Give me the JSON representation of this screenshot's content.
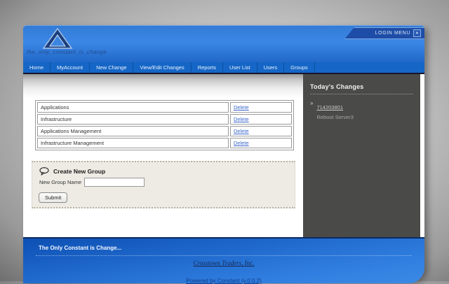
{
  "header": {
    "login_menu_label": "LOGIN MENU",
    "logo_tagline": "the_only_constant_is_change"
  },
  "icons": {
    "login_menu_arrow": "▴",
    "change_bullet": "»"
  },
  "nav": {
    "items": [
      {
        "label": "Home"
      },
      {
        "label": "MyAccount"
      },
      {
        "label": "New Change"
      },
      {
        "label": "View/Edit Changes"
      },
      {
        "label": "Reports"
      },
      {
        "label": "User List"
      },
      {
        "label": "Users"
      },
      {
        "label": "Groups"
      }
    ]
  },
  "groups_table": {
    "rows": [
      {
        "name": "Applications",
        "action": "Delete"
      },
      {
        "name": "Infrastructure",
        "action": "Delete"
      },
      {
        "name": "Applications Management",
        "action": "Delete"
      },
      {
        "name": "Infrastructure Management",
        "action": "Delete"
      }
    ]
  },
  "create_group": {
    "title": "Create New Group",
    "label": "New Group Name",
    "input_value": "",
    "submit_label": "Submit"
  },
  "sidebar": {
    "title": "Today's Changes",
    "entries": [
      {
        "id": "714203801",
        "description": "Reboot Server3"
      }
    ]
  },
  "footer": {
    "tagline": "The Only Constant is Change...",
    "company_link": "Crosstown Traders, Inc.",
    "powered_link": "Powered by Constant (v.0.0.2)"
  },
  "colors": {
    "header_blue": "#2f7bd8",
    "nav_blue": "#1566c6",
    "sidebar_gray": "#4a4a48",
    "footer_blue": "#1d63cc",
    "link_blue": "#3a66cc",
    "panel_beige": "#edebe3"
  }
}
